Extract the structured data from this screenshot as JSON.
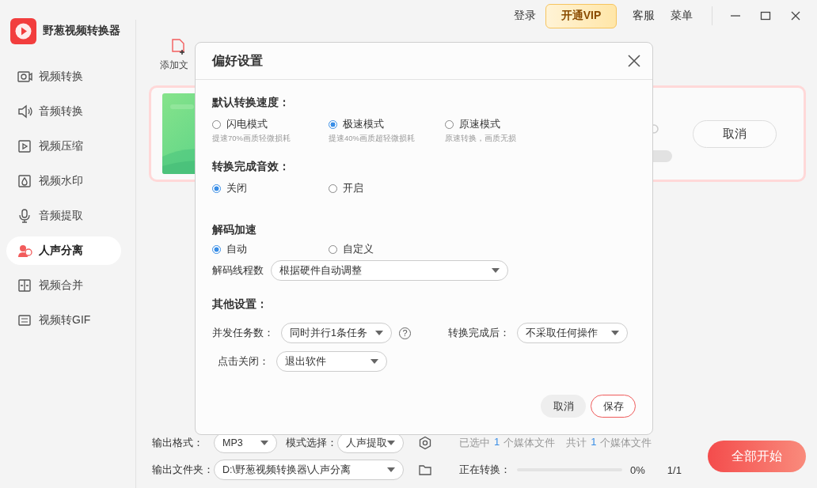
{
  "app": {
    "name": "野葱视频转换器"
  },
  "top_bar": {
    "login": "登录",
    "vip": "开通VIP",
    "service": "客服",
    "menu": "菜单"
  },
  "sidebar": {
    "items": [
      {
        "label": "视频转换",
        "selected": false
      },
      {
        "label": "音频转换",
        "selected": false
      },
      {
        "label": "视频压缩",
        "selected": false
      },
      {
        "label": "视频水印",
        "selected": false
      },
      {
        "label": "音频提取",
        "selected": false
      },
      {
        "label": "人声分离",
        "selected": true
      },
      {
        "label": "视频合并",
        "selected": false
      },
      {
        "label": "视频转GIF",
        "selected": false
      }
    ]
  },
  "toolbar": {
    "add_file": "添加文"
  },
  "task_card": {
    "cancel": "取消"
  },
  "dialog": {
    "title": "偏好设置",
    "speed": {
      "heading": "默认转换速度：",
      "options": [
        {
          "label": "闪电模式",
          "hint": "提速70%画质轻微损耗",
          "selected": false
        },
        {
          "label": "极速模式",
          "hint": "提速40%画质超轻微损耗",
          "selected": true
        },
        {
          "label": "原速模式",
          "hint": "原速转换，画质无损",
          "selected": false
        }
      ]
    },
    "sound": {
      "heading": "转换完成音效：",
      "options": [
        {
          "label": "关闭",
          "selected": true
        },
        {
          "label": "开启",
          "selected": false
        }
      ]
    },
    "decode": {
      "heading": "解码加速",
      "options": [
        {
          "label": "自动",
          "selected": true
        },
        {
          "label": "自定义",
          "selected": false
        }
      ],
      "threads_label": "解码线程数",
      "threads_value": "根据硬件自动调整"
    },
    "other": {
      "heading": "其他设置：",
      "concurrent_label": "并发任务数：",
      "concurrent_value": "同时并行1条任务",
      "help": "?",
      "after_label": "转换完成后：",
      "after_value": "不采取任何操作",
      "close_label": "点击关闭：",
      "close_value": "退出软件"
    },
    "buttons": {
      "cancel": "取消",
      "save": "保存"
    }
  },
  "bottom_bar": {
    "format_label": "输出格式：",
    "format_value": "MP3",
    "mode_label": "模式选择：",
    "mode_value": "人声提取",
    "selected_count": [
      "已选中",
      "1",
      "个媒体文件"
    ],
    "total_count": [
      "共计",
      "1",
      "个媒体文件"
    ],
    "folder_label": "输出文件夹：",
    "folder_value": "D:\\野葱视频转换器\\人声分离",
    "progress_label": "正在转换：",
    "progress": {
      "level": 0
    },
    "percent": "0%",
    "count": "1/1",
    "start": "全部开始"
  }
}
